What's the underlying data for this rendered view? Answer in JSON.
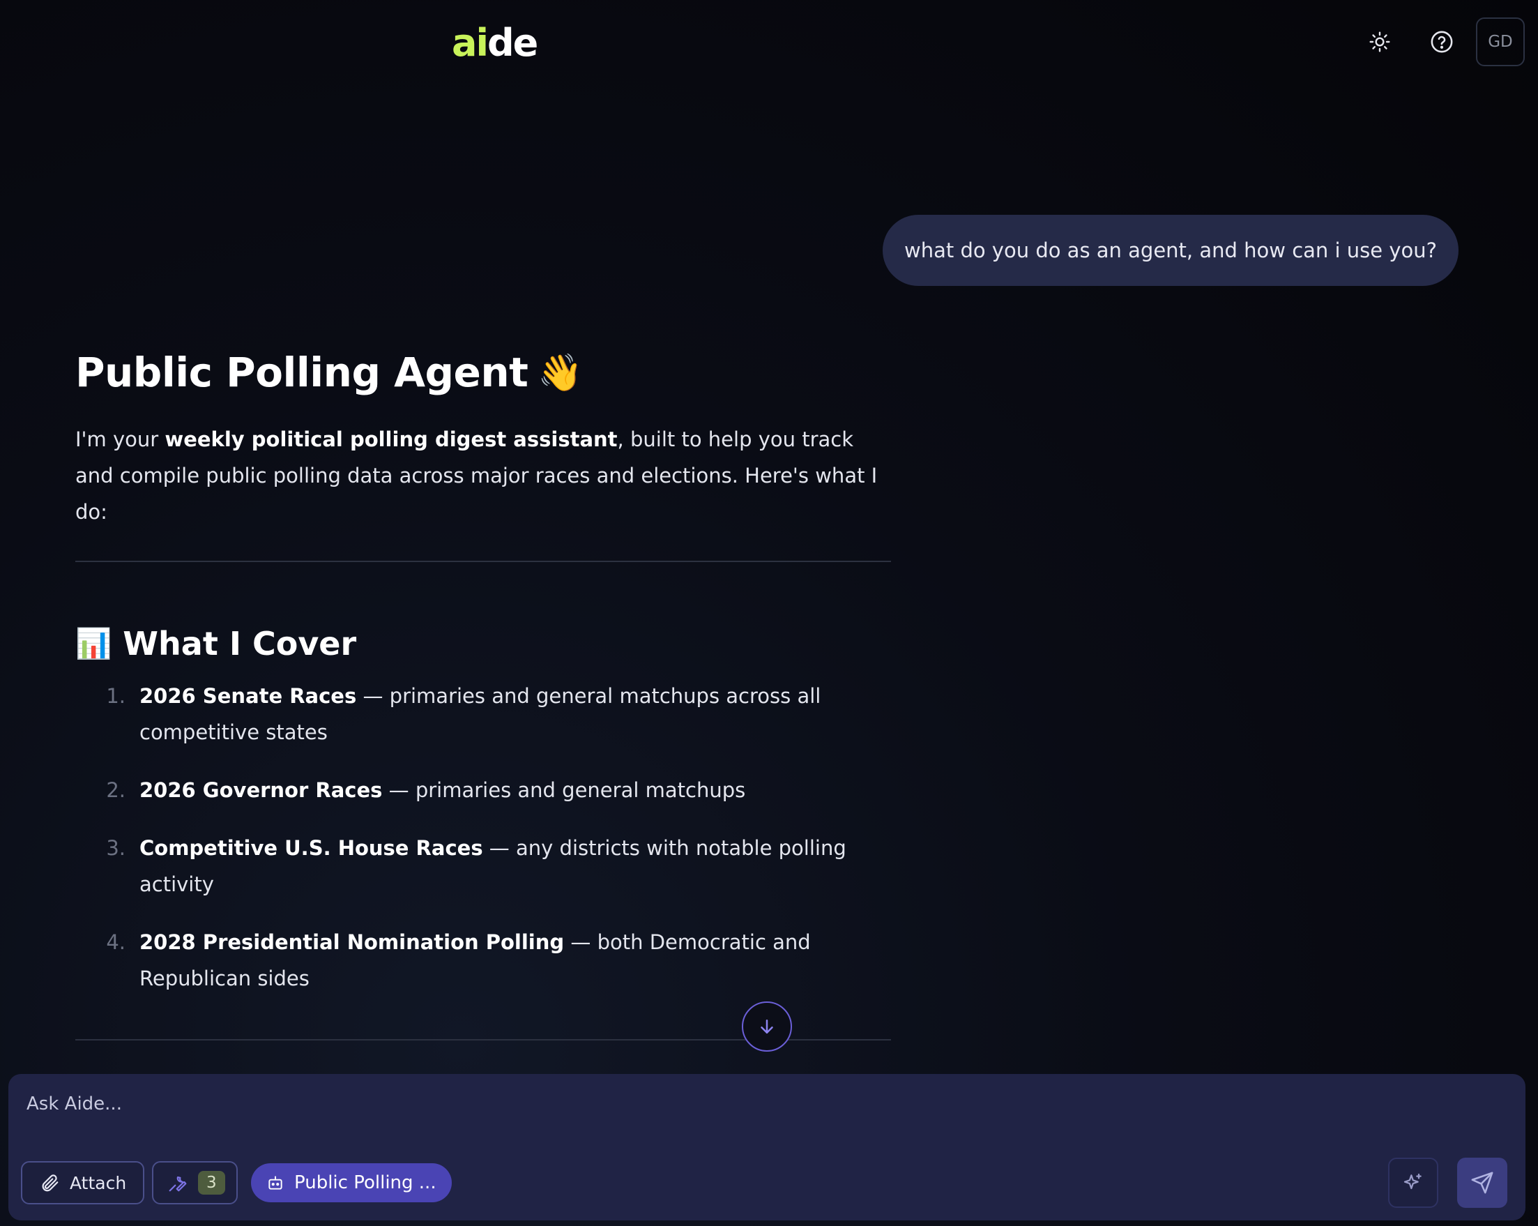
{
  "header": {
    "logo_part1": "ai",
    "logo_part2": "de",
    "theme_icon": "sun-icon",
    "help_icon": "help-circle-icon",
    "avatar_initials": "GD"
  },
  "chat": {
    "user_message": "what do you do as an agent, and how can i use you?",
    "response": {
      "title": "Public Polling Agent",
      "title_emoji": "👋",
      "intro_pre": "I'm your ",
      "intro_bold": "weekly political polling digest assistant",
      "intro_post": ", built to help you track and compile public polling data across major races and elections. Here's what I do:",
      "section_emoji": "📊",
      "section_title": "What I Cover",
      "items": [
        {
          "num": "1.",
          "bold": "2026 Senate Races",
          "text": " — primaries and general matchups across all competitive states"
        },
        {
          "num": "2.",
          "bold": "2026 Governor Races",
          "text": " — primaries and general matchups"
        },
        {
          "num": "3.",
          "bold": "Competitive U.S. House Races",
          "text": " — any districts with notable polling activity"
        },
        {
          "num": "4.",
          "bold": "2028 Presidential Nomination Polling",
          "text": " — both Democratic and Republican sides"
        }
      ]
    }
  },
  "composer": {
    "placeholder": "Ask Aide...",
    "attach_label": "Attach",
    "tools_count": "3",
    "agent_label": "Public Polling ..."
  },
  "colors": {
    "accent": "#4a44b4",
    "logo_green": "#c8f25a",
    "bubble": "#252a48",
    "composer": "#202345"
  }
}
